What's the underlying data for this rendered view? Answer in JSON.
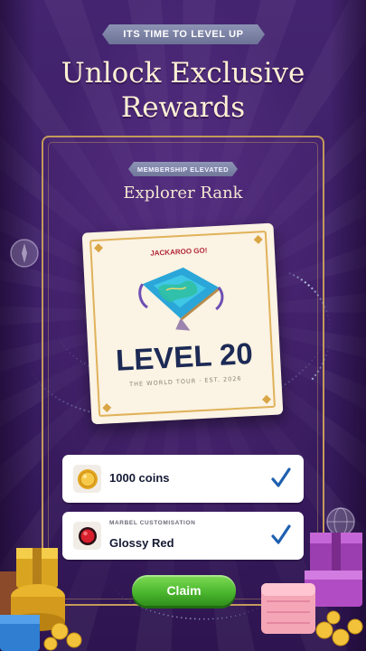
{
  "header": {
    "ribbon_text": "ITS TIME TO LEVEL UP",
    "title_line1": "Unlock Exclusive",
    "title_line2": "Rewards"
  },
  "panel": {
    "badge": "MEMBERSHIP ELEVATED",
    "rank_title": "Explorer Rank"
  },
  "level_card": {
    "brand": "JACKAROO GO!",
    "level_text": "LEVEL 20",
    "subtitle": "THE WORLD TOUR · EST. 2026",
    "art_icon": "treasure-map-icon"
  },
  "rewards": [
    {
      "category": "",
      "label": "1000 coins",
      "icon": "gold-coin-icon",
      "claimed": true
    },
    {
      "category": "MARBEL CUSTOMISATION",
      "label": "Glossy Red",
      "icon": "red-marble-icon",
      "claimed": true
    }
  ],
  "actions": {
    "claim_label": "Claim"
  },
  "colors": {
    "background": "#3a1e66",
    "frame_gold": "#c39a5c",
    "level_text": "#1c2a55",
    "brand_red": "#b3263a",
    "check_blue": "#1f5fb0",
    "claim_green": "#4cb82f"
  }
}
